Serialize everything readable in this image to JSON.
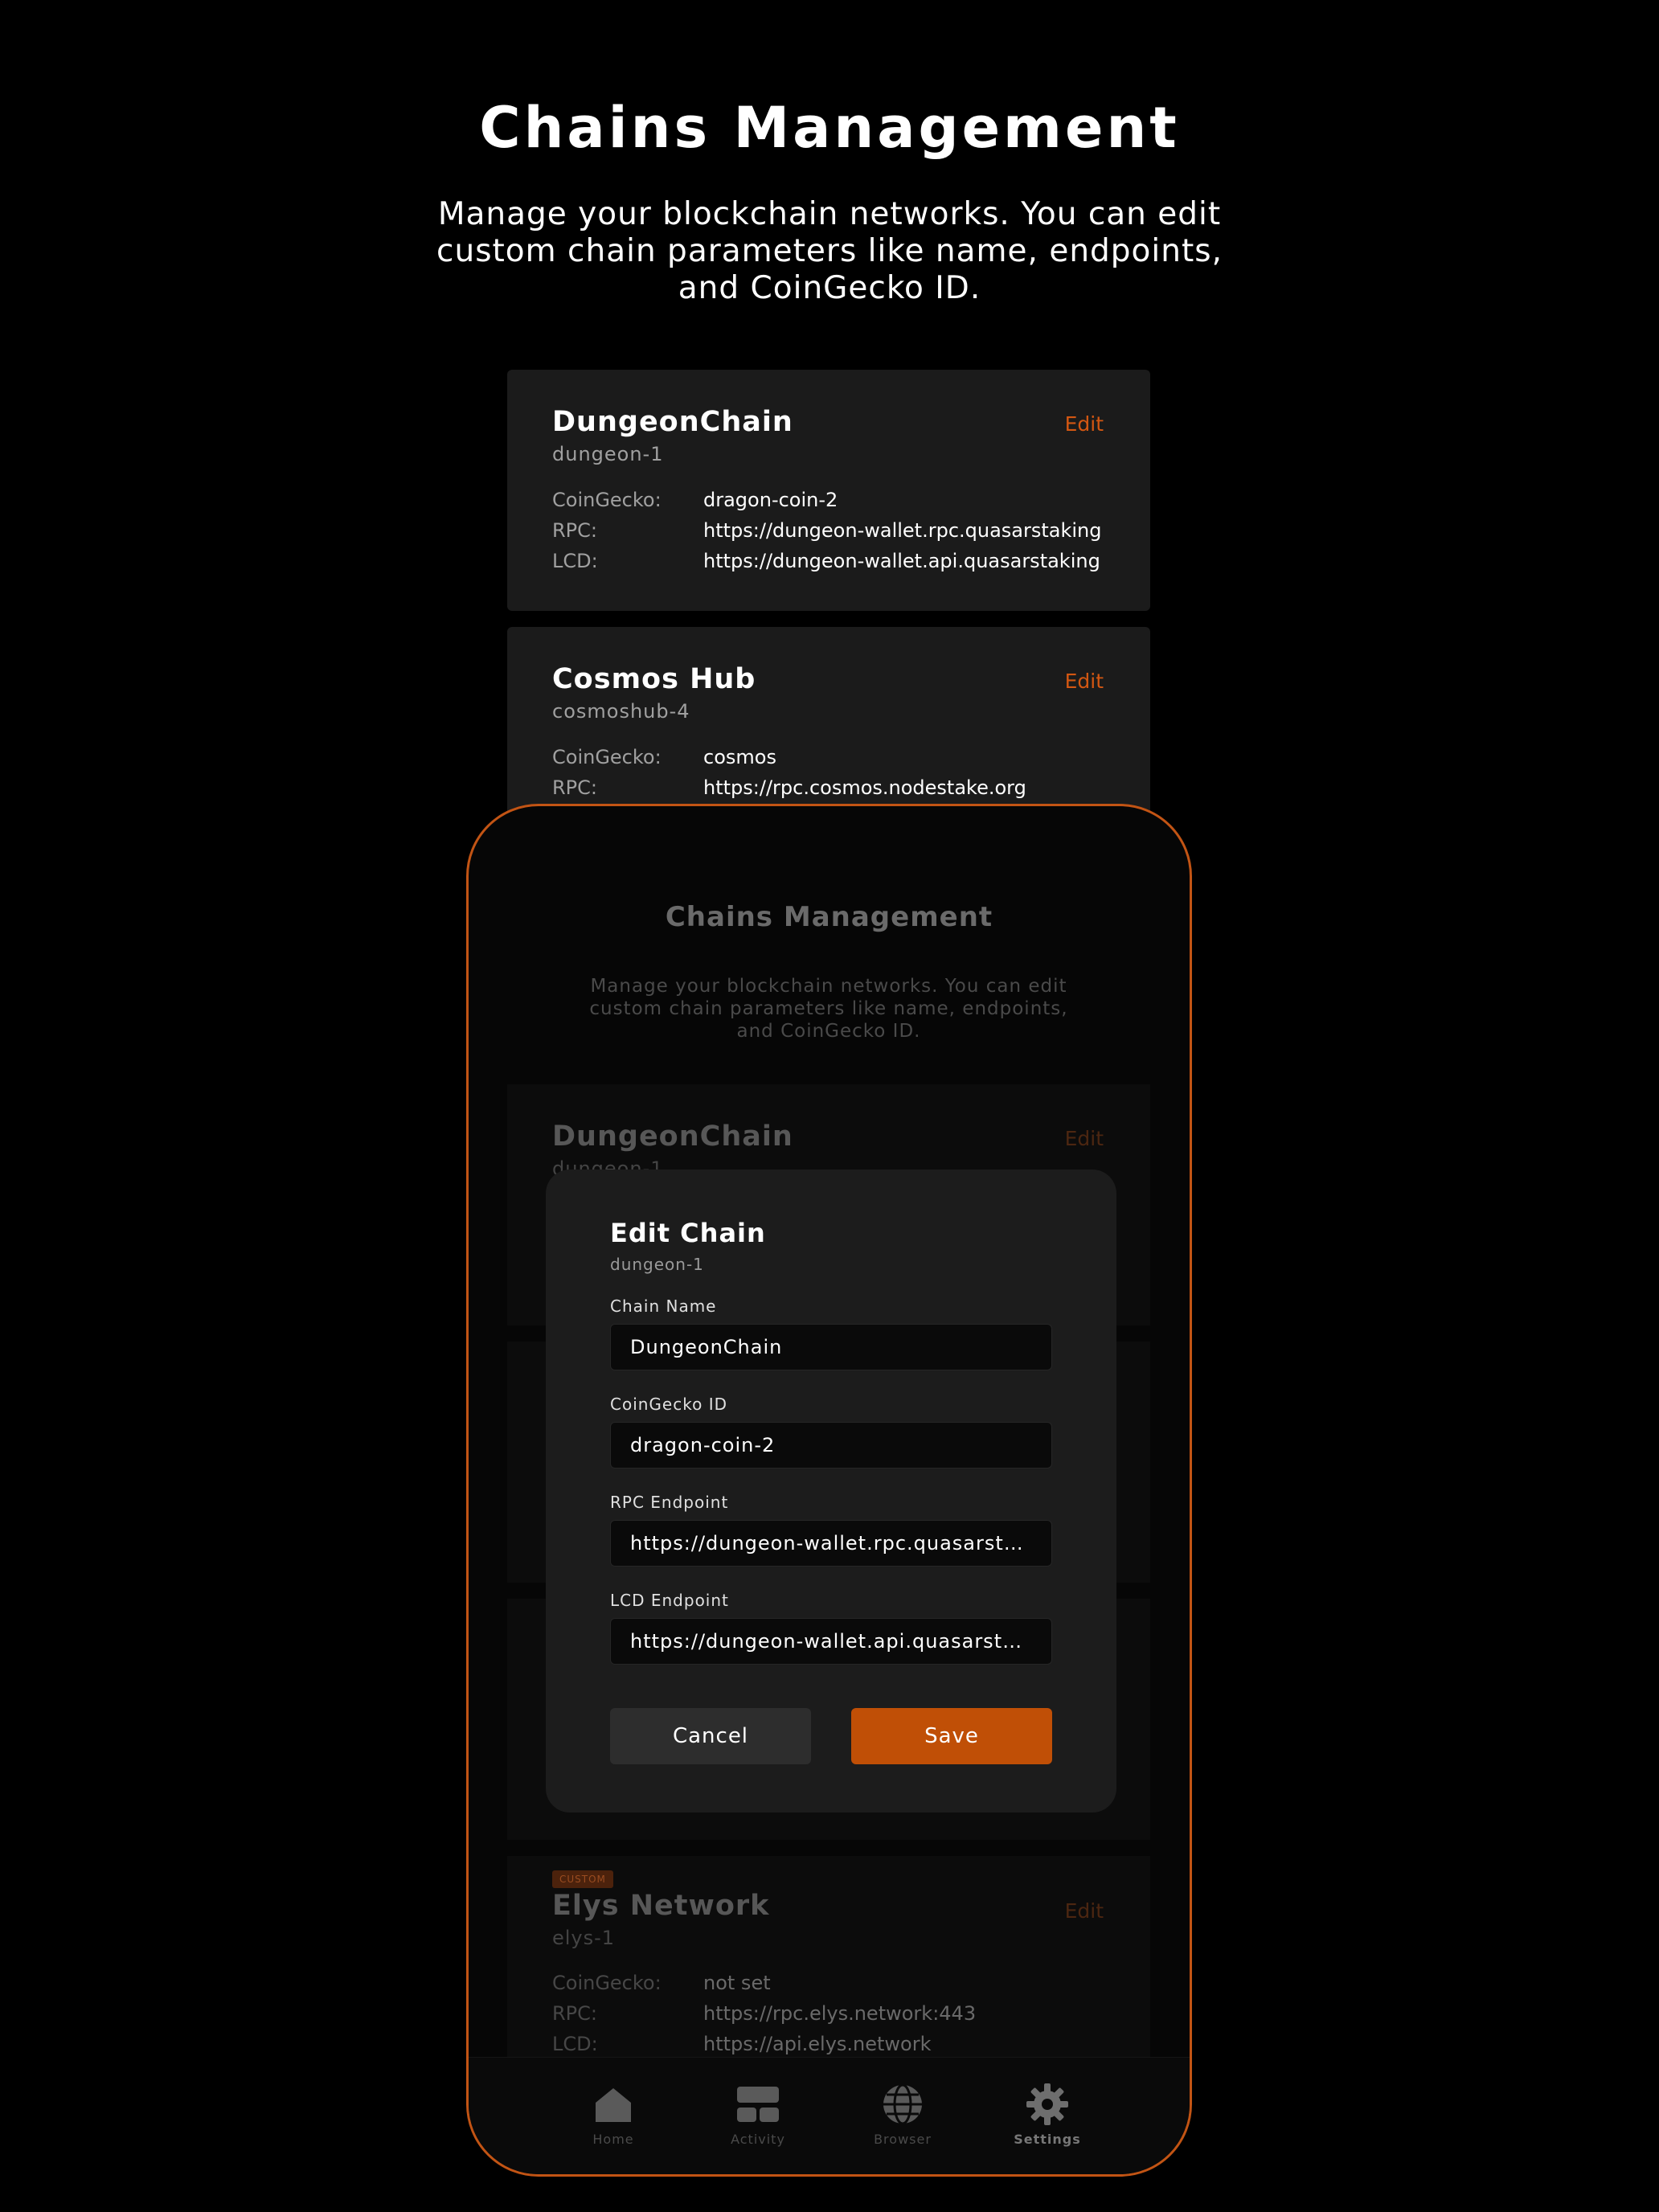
{
  "page": {
    "title": "Chains Management",
    "description": "Manage your blockchain networks. You can edit custom chain parameters like name, endpoints, and CoinGecko ID."
  },
  "labels": {
    "edit": "Edit",
    "coingecko": "CoinGecko:",
    "rpc": "RPC:",
    "lcd": "LCD:",
    "custom_badge": "CUSTOM"
  },
  "chains": [
    {
      "name": "DungeonChain",
      "chain_id": "dungeon-1",
      "coingecko": "dragon-coin-2",
      "rpc": "https://dungeon-wallet.rpc.quasarstaking",
      "lcd": "https://dungeon-wallet.api.quasarstaking"
    },
    {
      "name": "Cosmos Hub",
      "chain_id": "cosmoshub-4",
      "coingecko": "cosmos",
      "rpc": "https://rpc.cosmos.nodestake.org"
    },
    {
      "name": "Elys Network",
      "chain_id": "elys-1",
      "coingecko": "not set",
      "rpc": "https://rpc.elys.network:443",
      "lcd": "https://api.elys.network"
    }
  ],
  "modal": {
    "title": "Edit Chain",
    "subtitle": "dungeon-1",
    "fields": [
      {
        "label": "Chain Name",
        "value": "DungeonChain"
      },
      {
        "label": "CoinGecko ID",
        "value": "dragon-coin-2"
      },
      {
        "label": "RPC Endpoint",
        "value": "https://dungeon-wallet.rpc.quasarsta..."
      },
      {
        "label": "LCD Endpoint",
        "value": "https://dungeon-wallet.api.quasarsta..."
      }
    ],
    "cancel_label": "Cancel",
    "save_label": "Save"
  },
  "nav": {
    "items": [
      {
        "label": "Home",
        "icon": "home-icon"
      },
      {
        "label": "Activity",
        "icon": "activity-icon"
      },
      {
        "label": "Browser",
        "icon": "globe-icon"
      },
      {
        "label": "Settings",
        "icon": "gear-icon",
        "active": true
      }
    ]
  },
  "colors": {
    "accent": "#c04f06",
    "edit_link": "#d35712",
    "card_bg": "#1b1b1b",
    "background": "#000000"
  }
}
